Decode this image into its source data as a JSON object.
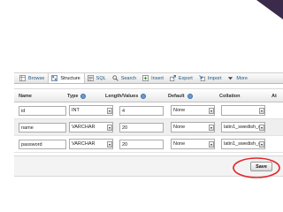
{
  "tabs": [
    {
      "label": "Browse",
      "icon": "browse-icon"
    },
    {
      "label": "Structure",
      "icon": "structure-icon"
    },
    {
      "label": "SQL",
      "icon": "sql-icon"
    },
    {
      "label": "Search",
      "icon": "search-icon"
    },
    {
      "label": "Insert",
      "icon": "insert-icon"
    },
    {
      "label": "Export",
      "icon": "export-icon"
    },
    {
      "label": "Import",
      "icon": "import-icon"
    },
    {
      "label": "More",
      "icon": "more-icon"
    }
  ],
  "columns": {
    "name": "Name",
    "type": "Type",
    "length": "Length/Values",
    "default": "Default",
    "collation": "Collation",
    "attributes": "At"
  },
  "rows": [
    {
      "name": "id",
      "type": "INT",
      "length": "4",
      "default": "None",
      "collation": ""
    },
    {
      "name": "name",
      "type": "VARCHAR",
      "length": "20",
      "default": "None",
      "collation": "latin1_swedish_ci"
    },
    {
      "name": "password",
      "type": "VARCHAR",
      "length": "20",
      "default": "None",
      "collation": "latin1_swedish_ci"
    }
  ],
  "actions": {
    "save_label": "Save"
  },
  "colors": {
    "corner_decoration": "#3b2a4a",
    "highlight_ring": "#e0282b",
    "link": "#235a81"
  }
}
